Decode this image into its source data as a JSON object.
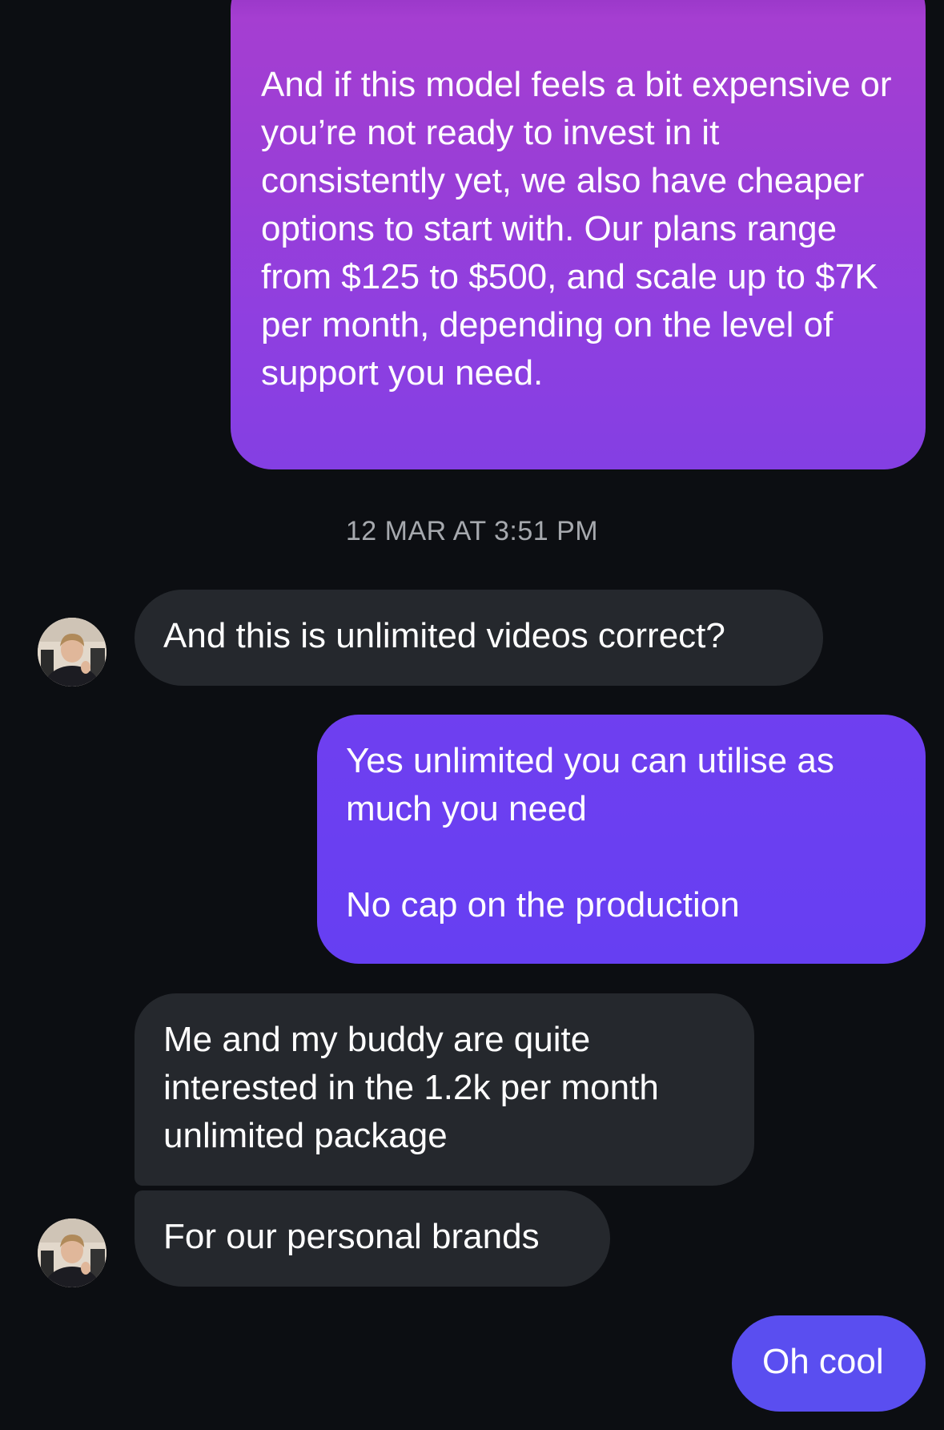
{
  "conversation": {
    "messages": [
      {
        "sender": "me",
        "text": "And if this model feels a bit expensive or you’re not ready to invest in it consistently yet, we also have cheaper options to start with. Our plans range from $125 to $500, and scale up to $7K per month, depending on the level of support you need."
      },
      {
        "sender": "contact",
        "text": "And this is unlimited videos correct?"
      },
      {
        "sender": "me",
        "text": "Yes unlimited you can utilise as much you need\n\nNo cap on the production"
      },
      {
        "sender": "contact",
        "text": "Me and my buddy are quite interested in the 1.2k per month unlimited package"
      },
      {
        "sender": "contact",
        "text": "For our personal brands"
      },
      {
        "sender": "me",
        "text": "Oh cool"
      }
    ],
    "timestamp": "12 MAR AT 3:51 PM"
  },
  "colors": {
    "background": "#0c0e12",
    "received_bubble": "#25282d",
    "sent_bubble_purple": "#9a3ed6",
    "sent_bubble_violet": "#6b3ff0",
    "sent_bubble_blue": "#5a4ef0",
    "timestamp_text": "#a6a9ae"
  }
}
